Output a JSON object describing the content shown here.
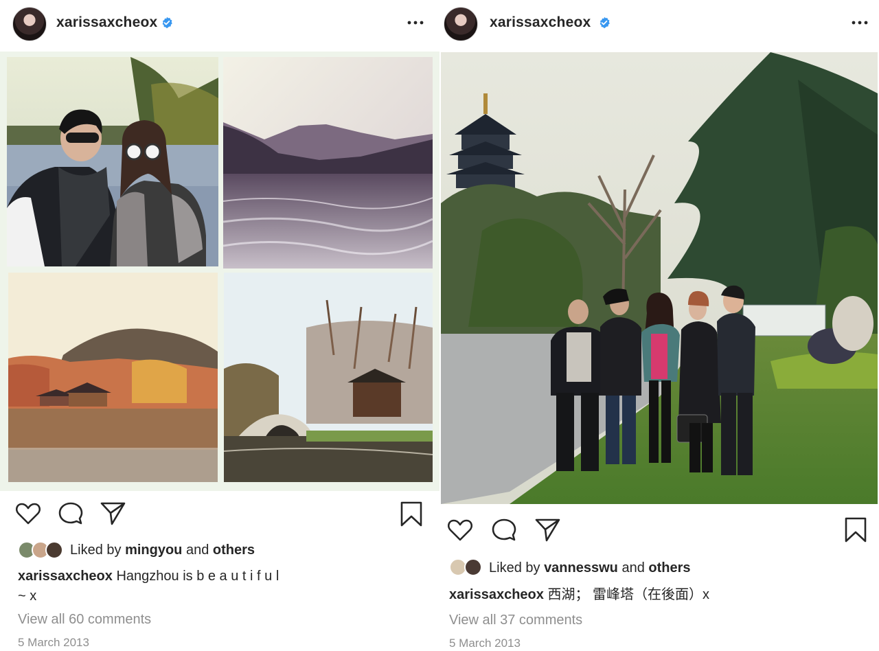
{
  "posts": [
    {
      "username": "xarissaxcheox",
      "liked_by_prefix": "Liked by",
      "liked_by_user": "mingyou",
      "and_text": "and",
      "others_text": "others",
      "caption_user": "xarissaxcheox",
      "caption_text": "Hangzhou is b e a u t i f u l",
      "caption_line2": "~ x",
      "view_comments": "View all 60 comments",
      "date": "5 March 2013"
    },
    {
      "username": "xarissaxcheox",
      "liked_by_prefix": "Liked by",
      "liked_by_user": "vannesswu",
      "and_text": "and",
      "others_text": "others",
      "caption_user": "xarissaxcheox",
      "caption_text": "西湖； 雷峰塔（在後面）x",
      "view_comments": "View all 37 comments",
      "date": "5 March 2013"
    }
  ],
  "icons": [
    "verified-badge-icon",
    "more-options-icon",
    "heart-icon",
    "comment-icon",
    "share-icon",
    "bookmark-icon"
  ],
  "colors": {
    "verified": "#3897f0",
    "text": "#262626",
    "muted": "#8e8e8e"
  }
}
